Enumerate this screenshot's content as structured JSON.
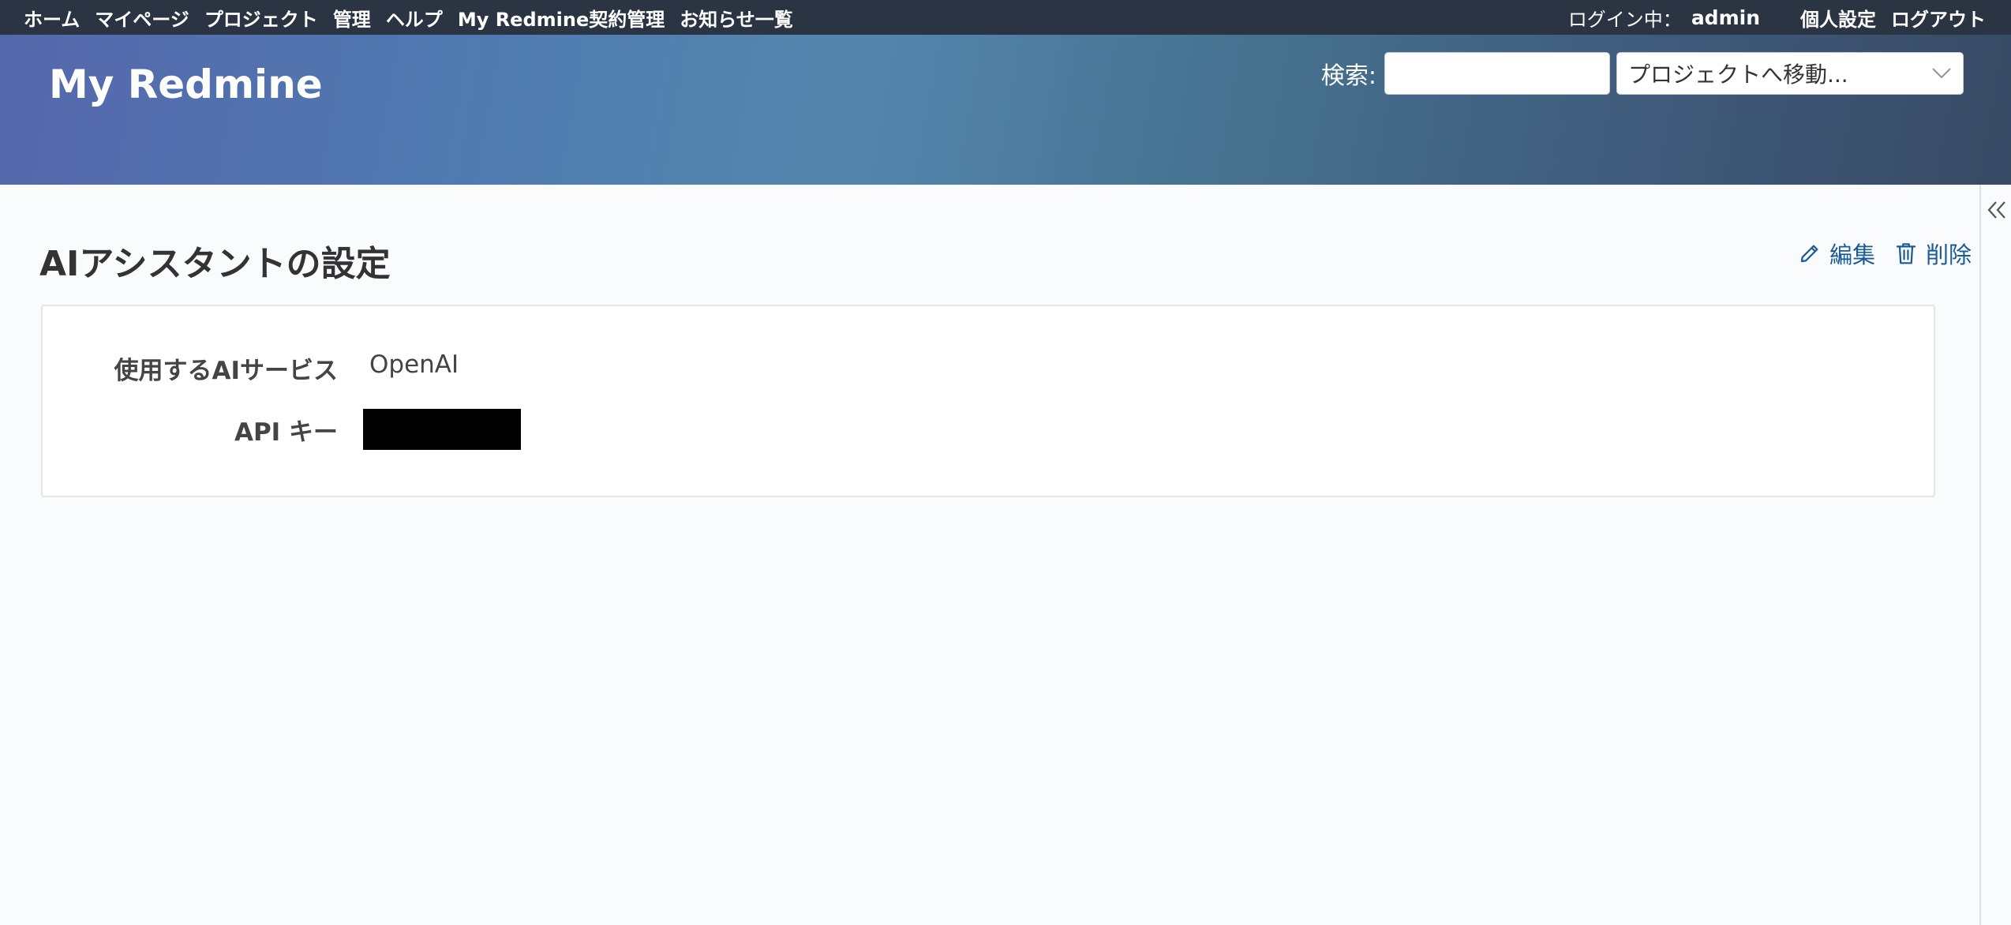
{
  "top_menu": {
    "items": [
      "ホーム",
      "マイページ",
      "プロジェクト",
      "管理",
      "ヘルプ",
      "My Redmine契約管理",
      "お知らせ一覧"
    ],
    "logged_in_label": "ログイン中：",
    "user": "admin",
    "my_account": "個人設定",
    "logout": "ログアウト"
  },
  "header": {
    "site_title": "My Redmine",
    "search_label": "検索:",
    "search_value": "",
    "project_jump": "プロジェクトへ移動..."
  },
  "content": {
    "title": "AIアシスタントの設定",
    "edit_label": "編集",
    "delete_label": "削除",
    "fields": [
      {
        "label": "使用するAIサービス",
        "value": "OpenAI"
      },
      {
        "label": "API キー",
        "value": ""
      }
    ]
  },
  "colors": {
    "top_menu_bg": "#2a3442",
    "link": "#1a5a95",
    "background": "#f9fbfd"
  }
}
